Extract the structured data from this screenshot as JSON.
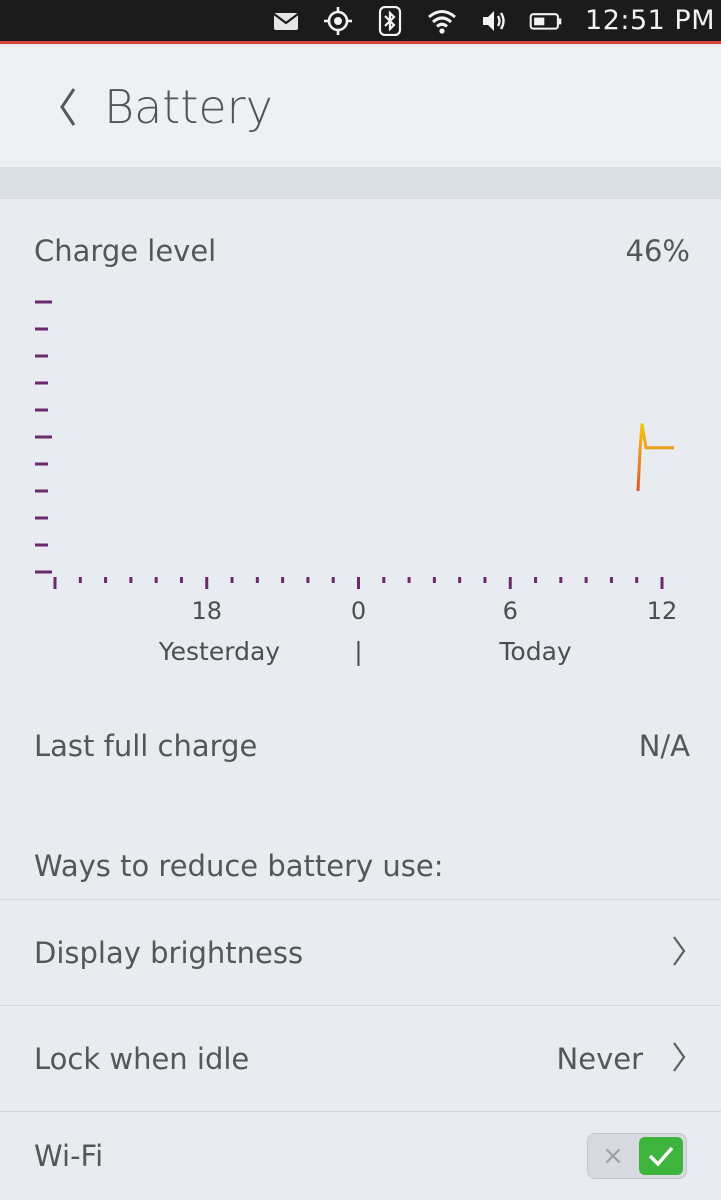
{
  "status_bar": {
    "time": "12:51 PM",
    "icons": [
      "mail-icon",
      "location-icon",
      "bluetooth-icon",
      "wifi-icon",
      "volume-icon",
      "battery-icon"
    ]
  },
  "header": {
    "title": "Battery",
    "back_icon": "chevron-left-icon"
  },
  "charge": {
    "label": "Charge level",
    "value": "46%"
  },
  "chart_data": {
    "type": "line",
    "x_ticks": [
      "18",
      "0",
      "6",
      "12"
    ],
    "day_labels": [
      "Yesterday",
      "Today"
    ],
    "day_separator": "|",
    "ylim": [
      0,
      100
    ],
    "grid": false,
    "series": [
      {
        "x_hours_before_now": [
          0.9,
          0.85,
          0.8,
          0.7,
          0.2,
          0.0
        ],
        "values": [
          30,
          45,
          55,
          46,
          46,
          46
        ]
      }
    ],
    "colors": {
      "axis": "#6a2a6b",
      "line_low": "#e0542a",
      "line_high": "#f2c80f"
    }
  },
  "last_full_charge": {
    "label": "Last full charge",
    "value": "N/A"
  },
  "reduce_section": {
    "label": "Ways to reduce battery use:"
  },
  "rows": {
    "display_brightness": {
      "label": "Display brightness"
    },
    "lock_when_idle": {
      "label": "Lock when idle",
      "value": "Never"
    },
    "wifi": {
      "label": "Wi-Fi",
      "toggle_on": true,
      "off_glyph": "×"
    }
  }
}
